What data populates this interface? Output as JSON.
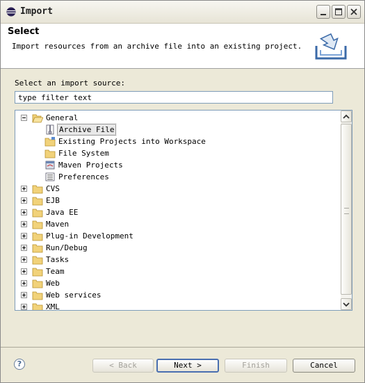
{
  "window": {
    "title": "Import"
  },
  "header": {
    "title": "Select",
    "description": "Import resources from an archive file into an existing project."
  },
  "source": {
    "label": "Select an import source:",
    "filter_value": "type filter text"
  },
  "tree": {
    "items": [
      {
        "label": "General",
        "level": 0,
        "expanded": true,
        "icon": "folder-open-icon"
      },
      {
        "label": "Archive File",
        "level": 1,
        "selected": true,
        "icon": "archive-file-icon"
      },
      {
        "label": "Existing Projects into Workspace",
        "level": 1,
        "icon": "existing-projects-icon"
      },
      {
        "label": "File System",
        "level": 1,
        "icon": "folder-icon"
      },
      {
        "label": "Maven Projects",
        "level": 1,
        "icon": "maven-projects-icon"
      },
      {
        "label": "Preferences",
        "level": 1,
        "icon": "preferences-icon"
      },
      {
        "label": "CVS",
        "level": 0,
        "expanded": false,
        "icon": "folder-icon"
      },
      {
        "label": "EJB",
        "level": 0,
        "expanded": false,
        "icon": "folder-icon"
      },
      {
        "label": "Java EE",
        "level": 0,
        "expanded": false,
        "icon": "folder-icon"
      },
      {
        "label": "Maven",
        "level": 0,
        "expanded": false,
        "icon": "folder-icon"
      },
      {
        "label": "Plug-in Development",
        "level": 0,
        "expanded": false,
        "icon": "folder-icon"
      },
      {
        "label": "Run/Debug",
        "level": 0,
        "expanded": false,
        "icon": "folder-icon"
      },
      {
        "label": "Tasks",
        "level": 0,
        "expanded": false,
        "icon": "folder-icon"
      },
      {
        "label": "Team",
        "level": 0,
        "expanded": false,
        "icon": "folder-icon"
      },
      {
        "label": "Web",
        "level": 0,
        "expanded": false,
        "icon": "folder-icon"
      },
      {
        "label": "Web services",
        "level": 0,
        "expanded": false,
        "icon": "folder-icon"
      },
      {
        "label": "XML",
        "level": 0,
        "expanded": false,
        "icon": "folder-icon"
      }
    ]
  },
  "buttons": {
    "back": "< Back",
    "next": "Next >",
    "finish": "Finish",
    "cancel": "Cancel",
    "help_glyph": "?"
  },
  "colors": {
    "folder": "#e8c25a",
    "selection_bg": "#e8e8e8",
    "default_button_border": "#4a6fb0"
  }
}
